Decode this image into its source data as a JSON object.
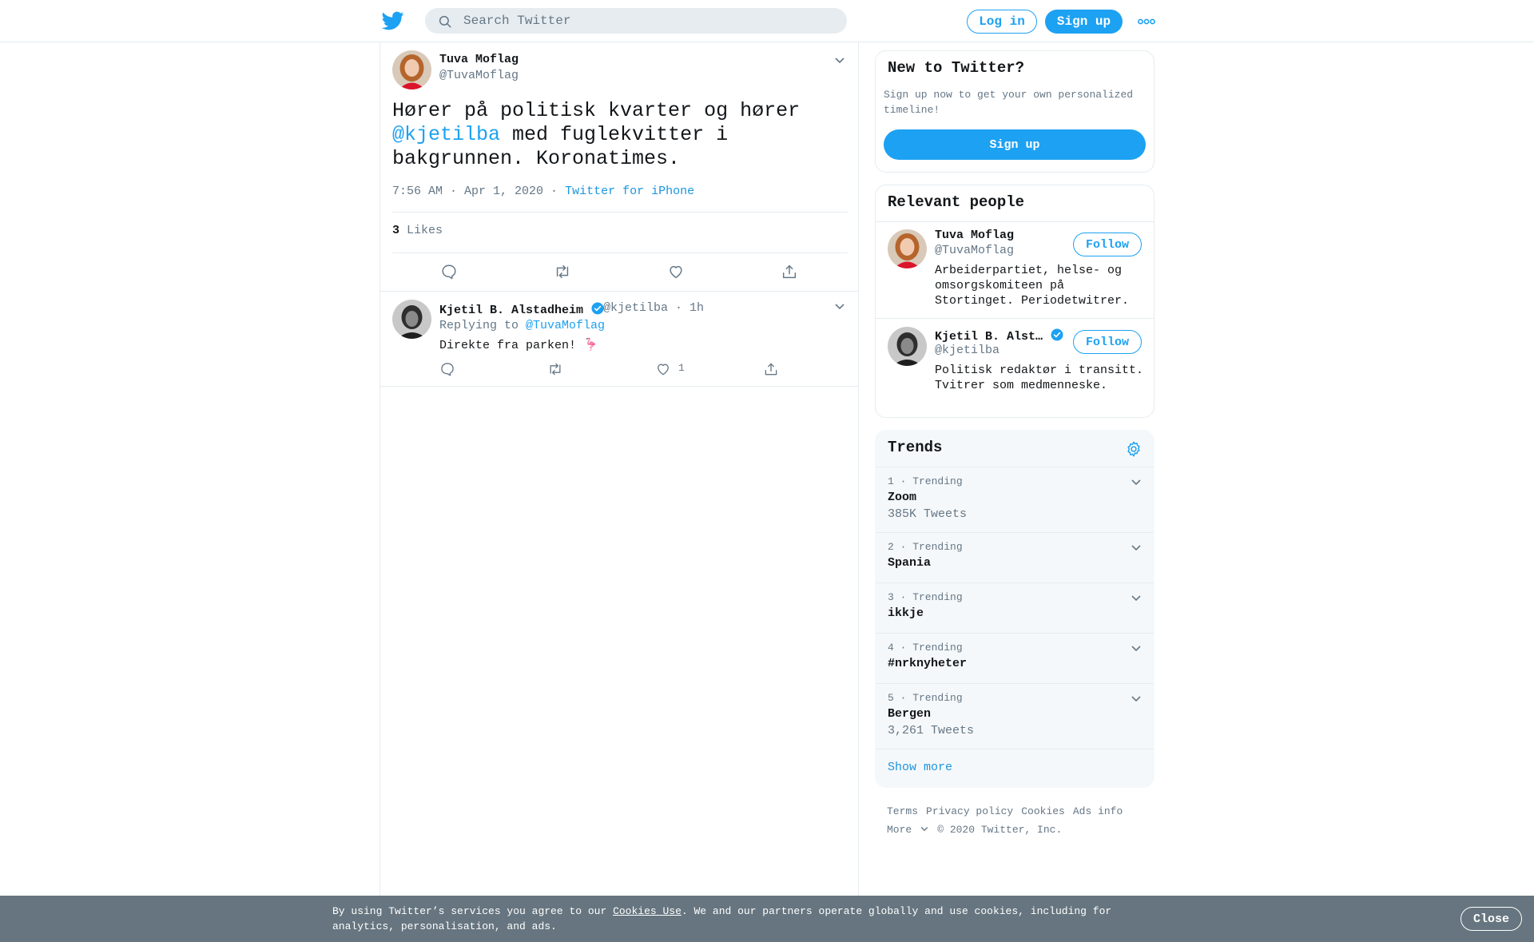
{
  "header": {
    "search_placeholder": "Search Twitter",
    "login_label": "Log in",
    "signup_label": "Sign up"
  },
  "tweet": {
    "author_name": "Tuva Moflag",
    "author_handle": "@TuvaMoflag",
    "text_part1": "Hører på politisk kvarter og hører ",
    "mention": "@kjetilba",
    "text_part2": " med fuglekvitter i bakgrunnen. Koronatimes.",
    "timestamp": "7:56 AM · Apr 1, 2020",
    "sep": "·",
    "source": "Twitter for iPhone",
    "likes_count": "3",
    "likes_label": "Likes"
  },
  "reply": {
    "author_name": "Kjetil B. Alstadheim",
    "author_handle": "@kjetilba",
    "time": "· 1h",
    "replying_to_label": "Replying to",
    "replying_to_handle": "@TuvaMoflag",
    "text": "Direkte fra parken! 🦩",
    "like_count": "1"
  },
  "new_to_twitter": {
    "title": "New to Twitter?",
    "subtitle": "Sign up now to get your own personalized timeline!",
    "signup_label": "Sign up"
  },
  "relevant_people": {
    "title": "Relevant people",
    "people": [
      {
        "name": "Tuva Moflag",
        "handle": "@TuvaMoflag",
        "bio": "Arbeiderpartiet, helse- og omsorgskomiteen på Stortinget. Periodetwitrer.",
        "follow_label": "Follow"
      },
      {
        "name": "Kjetil B. Alst…",
        "handle": "@kjetilba",
        "bio": "Politisk redaktør i transitt. Tvitrer som medmenneske.",
        "follow_label": "Follow"
      }
    ]
  },
  "trends": {
    "title": "Trends",
    "items": [
      {
        "meta": "1 · Trending",
        "name": "Zoom",
        "count": "385K Tweets"
      },
      {
        "meta": "2 · Trending",
        "name": "Spania",
        "count": ""
      },
      {
        "meta": "3 · Trending",
        "name": "ikkje",
        "count": ""
      },
      {
        "meta": "4 · Trending",
        "name": "#nrknyheter",
        "count": ""
      },
      {
        "meta": "5 · Trending",
        "name": "Bergen",
        "count": "3,261 Tweets"
      }
    ],
    "show_more": "Show more"
  },
  "footer": {
    "links": [
      "Terms",
      "Privacy policy",
      "Cookies",
      "Ads info",
      "More"
    ],
    "copyright": "© 2020 Twitter, Inc."
  },
  "cookie_bar": {
    "text_before": "By using Twitter’s services you agree to our ",
    "link": "Cookies Use",
    "text_after": ". We and our partners operate globally and use cookies, including for analytics, personalisation, and ads.",
    "close_label": "Close"
  },
  "colors": {
    "brand": "#1da1f2",
    "text_secondary": "#657786",
    "border": "#e6ecf0",
    "cookie_bar": "#66757f"
  }
}
